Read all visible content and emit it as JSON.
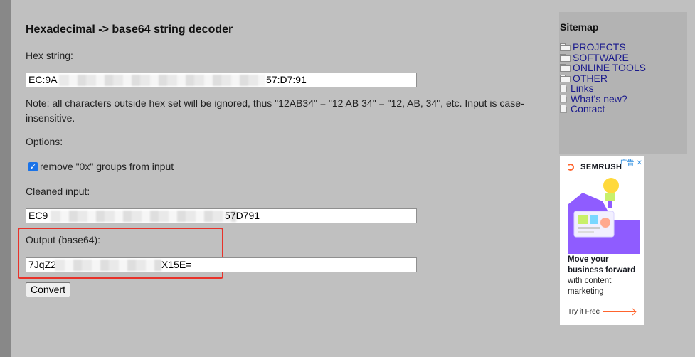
{
  "page": {
    "title": "Hexadecimal -> base64 string decoder",
    "hex_label": "Hex string:",
    "hex_value_start": "EC:9A",
    "hex_value_end": "57:D7:91",
    "note": "Note: all characters outside hex set will be ignored, thus \"12AB34\" = \"12 AB 34\" = \"12, AB, 34\", etc. Input is case-insensitive.",
    "options_label": "Options:",
    "remove_0x_label": "remove \"0x\" groups from input",
    "remove_0x_checked": true,
    "cleaned_label": "Cleaned input:",
    "cleaned_value_start": "EC9",
    "cleaned_value_end": "57D791",
    "output_label": "Output (base64):",
    "output_value_start": "7JqZ2",
    "output_value_end": "X15E=",
    "convert_label": "Convert"
  },
  "sidebar": {
    "title": "Sitemap",
    "items": [
      {
        "label": "PROJECTS",
        "icon": "folder-icon"
      },
      {
        "label": "SOFTWARE",
        "icon": "folder-icon"
      },
      {
        "label": "ONLINE TOOLS",
        "icon": "folder-icon"
      },
      {
        "label": "OTHER",
        "icon": "folder-icon"
      },
      {
        "label": "Links",
        "icon": "page-icon"
      },
      {
        "label": "What's new?",
        "icon": "page-icon"
      },
      {
        "label": "Contact",
        "icon": "page-icon"
      }
    ]
  },
  "ad": {
    "badge": "广告",
    "brand": "SEMRUSH",
    "headline": "Move your business forward",
    "body": "with content marketing",
    "cta": "Try it Free"
  },
  "colors": {
    "background": "#c0c0c0",
    "highlight_border": "#e8322a",
    "link": "#1a1a8c",
    "brand_orange": "#ff642d",
    "checkbox": "#1a73e8"
  }
}
